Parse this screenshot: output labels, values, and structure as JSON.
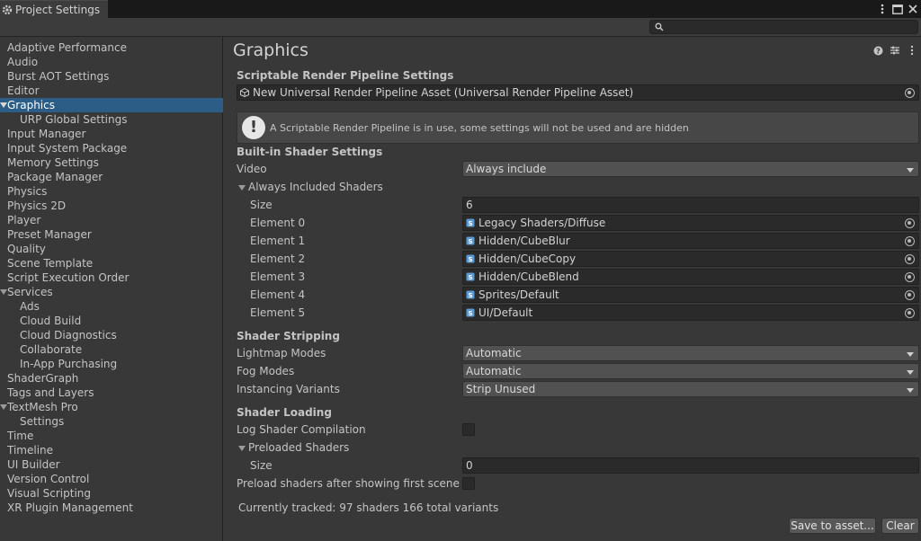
{
  "window": {
    "tab_title": "Project Settings"
  },
  "search": {
    "placeholder": ""
  },
  "sidebar": {
    "items": [
      {
        "label": "Adaptive Performance"
      },
      {
        "label": "Audio"
      },
      {
        "label": "Burst AOT Settings"
      },
      {
        "label": "Editor"
      },
      {
        "label": "Graphics"
      },
      {
        "label": "URP Global Settings"
      },
      {
        "label": "Input Manager"
      },
      {
        "label": "Input System Package"
      },
      {
        "label": "Memory Settings"
      },
      {
        "label": "Package Manager"
      },
      {
        "label": "Physics"
      },
      {
        "label": "Physics 2D"
      },
      {
        "label": "Player"
      },
      {
        "label": "Preset Manager"
      },
      {
        "label": "Quality"
      },
      {
        "label": "Scene Template"
      },
      {
        "label": "Script Execution Order"
      },
      {
        "label": "Services"
      },
      {
        "label": "Ads"
      },
      {
        "label": "Cloud Build"
      },
      {
        "label": "Cloud Diagnostics"
      },
      {
        "label": "Collaborate"
      },
      {
        "label": "In-App Purchasing"
      },
      {
        "label": "ShaderGraph"
      },
      {
        "label": "Tags and Layers"
      },
      {
        "label": "TextMesh Pro"
      },
      {
        "label": "Settings"
      },
      {
        "label": "Time"
      },
      {
        "label": "Timeline"
      },
      {
        "label": "UI Builder"
      },
      {
        "label": "Version Control"
      },
      {
        "label": "Visual Scripting"
      },
      {
        "label": "XR Plugin Management"
      }
    ]
  },
  "main": {
    "title": "Graphics",
    "srp": {
      "heading": "Scriptable Render Pipeline Settings",
      "asset": "New Universal Render Pipeline Asset (Universal Render Pipeline Asset)",
      "help": "A Scriptable Render Pipeline is in use, some settings will not be used and are hidden"
    },
    "builtin": {
      "heading": "Built-in Shader Settings",
      "video_label": "Video",
      "video_value": "Always include",
      "always_included_label": "Always Included Shaders",
      "size_label": "Size",
      "size_value": "6",
      "elements": [
        {
          "label": "Element 0",
          "value": "Legacy Shaders/Diffuse"
        },
        {
          "label": "Element 1",
          "value": "Hidden/CubeBlur"
        },
        {
          "label": "Element 2",
          "value": "Hidden/CubeCopy"
        },
        {
          "label": "Element 3",
          "value": "Hidden/CubeBlend"
        },
        {
          "label": "Element 4",
          "value": "Sprites/Default"
        },
        {
          "label": "Element 5",
          "value": "UI/Default"
        }
      ]
    },
    "stripping": {
      "heading": "Shader Stripping",
      "lightmap_label": "Lightmap Modes",
      "lightmap_value": "Automatic",
      "fog_label": "Fog Modes",
      "fog_value": "Automatic",
      "instancing_label": "Instancing Variants",
      "instancing_value": "Strip Unused"
    },
    "loading": {
      "heading": "Shader Loading",
      "log_label": "Log Shader Compilation",
      "preloaded_label": "Preloaded Shaders",
      "size_label": "Size",
      "size_value": "0",
      "preload_after_label": "Preload shaders after showing first scene"
    },
    "tracked": "Currently tracked: 97 shaders 166 total variants",
    "save_button": "Save to asset...",
    "clear_button": "Clear"
  }
}
